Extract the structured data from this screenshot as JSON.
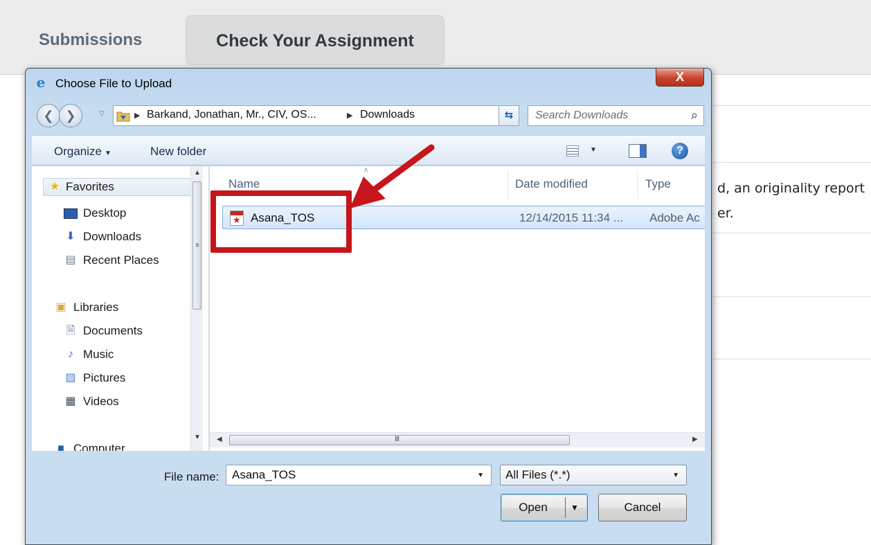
{
  "page": {
    "tabs": [
      {
        "label": "Submissions"
      },
      {
        "label": "Check Your Assignment"
      }
    ],
    "background_text_line1": "d, an originality report",
    "background_text_line2": "er."
  },
  "dialog": {
    "title": "Choose File to Upload",
    "close_label": "X",
    "address": {
      "crumbs": [
        "Barkand, Jonathan, Mr., CIV, OS...",
        "Downloads"
      ]
    },
    "search": {
      "placeholder": "Search Downloads"
    },
    "commands": {
      "organize": "Organize",
      "new_folder": "New folder"
    },
    "nav": {
      "favorites_header": "Favorites",
      "favorites": [
        {
          "label": "Desktop",
          "icon": "desktop-icon"
        },
        {
          "label": "Downloads",
          "icon": "downloads-folder-icon"
        },
        {
          "label": "Recent Places",
          "icon": "recent-places-icon"
        }
      ],
      "libraries_header": "Libraries",
      "libraries": [
        {
          "label": "Documents",
          "icon": "documents-icon"
        },
        {
          "label": "Music",
          "icon": "music-icon"
        },
        {
          "label": "Pictures",
          "icon": "pictures-icon"
        },
        {
          "label": "Videos",
          "icon": "videos-icon"
        }
      ],
      "computer": "Computer"
    },
    "columns": {
      "name": "Name",
      "date_modified": "Date modified",
      "type": "Type"
    },
    "files": [
      {
        "name": "Asana_TOS",
        "date_modified": "12/14/2015 11:34 ...",
        "type": "Adobe Ac",
        "icon": "pdf-file-icon"
      }
    ],
    "scroll_grip": "III",
    "file_name_label": "File name:",
    "file_name_value": "Asana_TOS",
    "filter": "All Files (*.*)",
    "open_label": "Open",
    "cancel_label": "Cancel"
  },
  "colors": {
    "annotation_red": "#c7161b",
    "selection_blue": "#d3e6fb"
  }
}
